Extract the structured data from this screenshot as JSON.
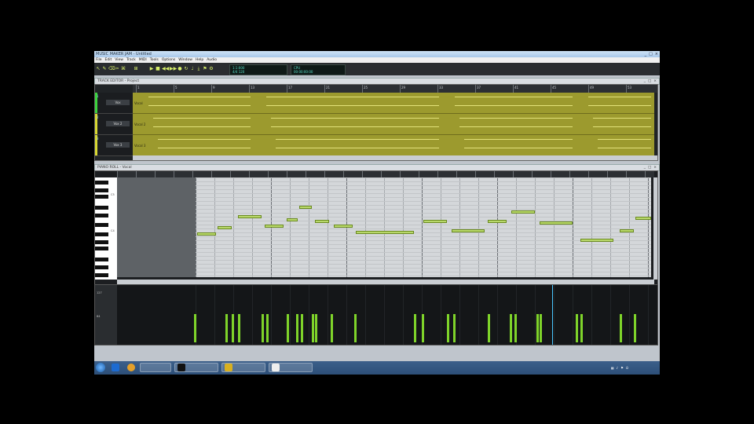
{
  "window": {
    "title": "MUSIC MAKER JAM - Untitled",
    "controls": [
      "_",
      "□",
      "×"
    ]
  },
  "menu": [
    "File",
    "Edit",
    "View",
    "Track",
    "MIDI",
    "Tools",
    "Options",
    "Window",
    "Help",
    "Audio"
  ],
  "toolbar": {
    "lcd1": {
      "top": "1:1:000",
      "bottom": "4/4  120"
    },
    "lcd2": {
      "top": "CPU",
      "bottom": "00:00:00:00"
    }
  },
  "arrange": {
    "title": "TRACK EDITOR - Project",
    "ruler": [
      "1",
      "5",
      "9",
      "13",
      "17",
      "21",
      "25",
      "29",
      "33",
      "37",
      "41",
      "45",
      "49",
      "53"
    ],
    "tracks": [
      {
        "num": "1",
        "name": "Vox",
        "clip": "Vocal",
        "strip_color": "#3cd33c"
      },
      {
        "num": "2",
        "name": "Vox 2",
        "clip": "Vocal 2",
        "strip_color": "#d8d830"
      },
      {
        "num": "3",
        "name": "Vox 3",
        "clip": "Vocal 3",
        "strip_color": "#d8d830"
      }
    ]
  },
  "pianoroll": {
    "title": "PIANO ROLL - Vocal",
    "key_labels": [
      "C5",
      "C4"
    ]
  },
  "velocity": {
    "labels": [
      "127",
      "64"
    ]
  },
  "taskbar": {
    "apps": [
      "",
      "",
      "",
      ""
    ],
    "clock_time": "",
    "clock_date": ""
  }
}
